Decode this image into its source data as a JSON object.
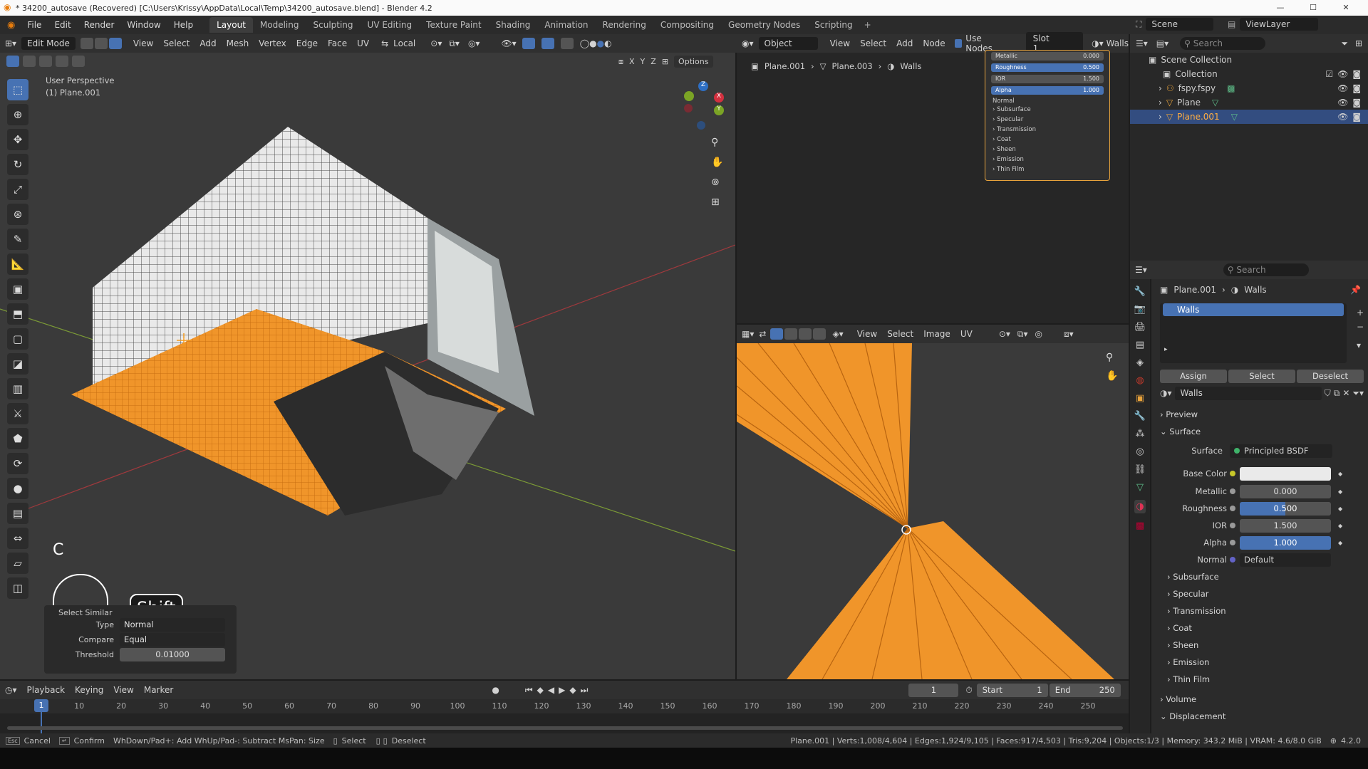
{
  "window": {
    "title": "* 34200_autosave (Recovered) [C:\\Users\\Krissy\\AppData\\Local\\Temp\\34200_autosave.blend] - Blender 4.2"
  },
  "menus": [
    "File",
    "Edit",
    "Render",
    "Window",
    "Help"
  ],
  "workspaces": [
    "Layout",
    "Modeling",
    "Sculpting",
    "UV Editing",
    "Texture Paint",
    "Shading",
    "Animation",
    "Rendering",
    "Compositing",
    "Geometry Nodes",
    "Scripting"
  ],
  "scene": {
    "name": "Scene",
    "view_layer": "ViewLayer"
  },
  "viewport": {
    "mode": "Edit Mode",
    "menus": [
      "View",
      "Select",
      "Add",
      "Mesh",
      "Vertex",
      "Edge",
      "Face",
      "UV"
    ],
    "orientation": "Local",
    "overlay_label": "User Perspective",
    "object_label": "(1) Plane.001",
    "options": "Options",
    "axes": [
      "X",
      "Y",
      "Z"
    ],
    "key_c": "C",
    "key_shift": "Shift"
  },
  "select_similar": {
    "title": "Select Similar",
    "type_label": "Type",
    "type_value": "Normal",
    "compare_label": "Compare",
    "compare_value": "Equal",
    "threshold_label": "Threshold",
    "threshold_value": "0.01000"
  },
  "node_editor": {
    "object_mode": "Object",
    "menus": [
      "View",
      "Select",
      "Add",
      "Node"
    ],
    "use_nodes": "Use Nodes",
    "slot": "Slot 1",
    "material": "Walls",
    "breadcrumb": [
      "Plane.001",
      "Plane.003",
      "Walls"
    ],
    "mini_props": [
      {
        "label": "Metallic",
        "value": "0.000"
      },
      {
        "label": "Roughness",
        "value": "0.500"
      },
      {
        "label": "IOR",
        "value": "1.500"
      },
      {
        "label": "Alpha",
        "value": "1.000"
      }
    ],
    "mini_normal": "Normal",
    "mini_sections": [
      "Subsurface",
      "Specular",
      "Transmission",
      "Coat",
      "Sheen",
      "Emission",
      "Thin Film"
    ]
  },
  "uv_editor": {
    "menus": [
      "View",
      "Select",
      "Image",
      "UV"
    ]
  },
  "outliner": {
    "search": "Search",
    "items": [
      {
        "name": "Scene Collection"
      },
      {
        "name": "Collection"
      },
      {
        "name": "fspy.fspy"
      },
      {
        "name": "Plane"
      },
      {
        "name": "Plane.001"
      }
    ]
  },
  "properties": {
    "search": "Search",
    "breadcrumb": [
      "Plane.001",
      "Walls"
    ],
    "slot_name": "Walls",
    "assign": "Assign",
    "select": "Select",
    "deselect": "Deselect",
    "material": "Walls",
    "preview": "Preview",
    "surface_section": "Surface",
    "surface": {
      "label": "Surface",
      "value": "Principled BSDF"
    },
    "fields": [
      {
        "label": "Base Color",
        "value": ""
      },
      {
        "label": "Metallic",
        "value": "0.000"
      },
      {
        "label": "Roughness",
        "value": "0.500"
      },
      {
        "label": "IOR",
        "value": "1.500"
      },
      {
        "label": "Alpha",
        "value": "1.000"
      },
      {
        "label": "Normal",
        "value": "Default"
      }
    ],
    "subsections": [
      "Subsurface",
      "Specular",
      "Transmission",
      "Coat",
      "Sheen",
      "Emission",
      "Thin Film"
    ],
    "volume": "Volume",
    "displacement": "Displacement"
  },
  "timeline": {
    "menus": [
      "Playback",
      "Keying",
      "View",
      "Marker"
    ],
    "current": "1",
    "start_label": "Start",
    "start": "1",
    "end_label": "End",
    "end": "250",
    "ticks": [
      "1",
      "10",
      "20",
      "30",
      "40",
      "50",
      "60",
      "70",
      "80",
      "90",
      "100",
      "110",
      "120",
      "130",
      "140",
      "150",
      "160",
      "170",
      "180",
      "190",
      "200",
      "210",
      "220",
      "230",
      "240",
      "250"
    ]
  },
  "statusbar": {
    "cancel": "Cancel",
    "confirm": "Confirm",
    "hint": "WhDown/Pad+: Add WhUp/Pad-: Subtract MsPan: Size",
    "select": "Select",
    "deselect": "Deselect",
    "stats": "Plane.001 | Verts:1,008/4,604 | Edges:1,924/9,105 | Faces:917/4,503 | Tris:9,204 | Objects:1/3 | Memory: 343.2 MiB | VRAM: 4.6/8.0 GiB",
    "version": "4.2.0"
  },
  "colors": {
    "accent": "#4772b3",
    "selection": "#f39a1f",
    "bg": "#3a3a3a"
  }
}
